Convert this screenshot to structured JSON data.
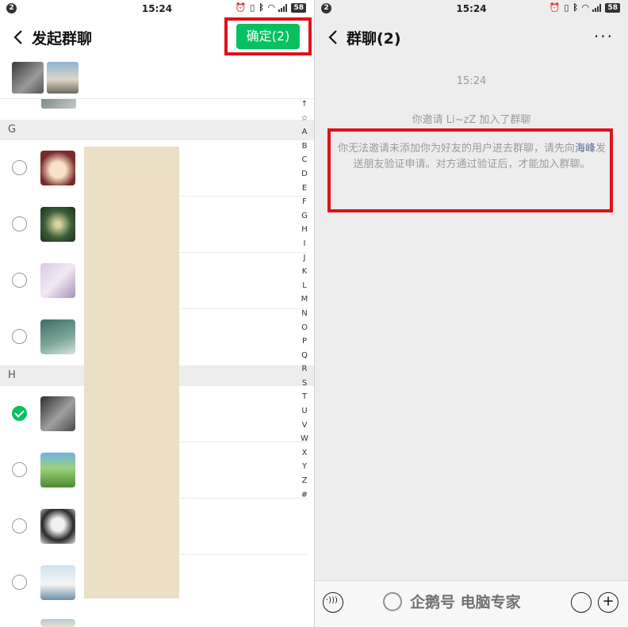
{
  "left": {
    "status": {
      "notif": "2",
      "time": "15:24",
      "battery": "58"
    },
    "nav": {
      "title": "发起群聊",
      "confirm_label": "确定(2)"
    },
    "sections": [
      {
        "letter": "G"
      },
      {
        "letter": "H"
      }
    ],
    "index_letters": [
      "↑",
      "☆",
      "A",
      "B",
      "C",
      "D",
      "E",
      "F",
      "G",
      "H",
      "I",
      "J",
      "K",
      "L",
      "M",
      "N",
      "O",
      "P",
      "Q",
      "R",
      "S",
      "T",
      "U",
      "V",
      "W",
      "X",
      "Y",
      "Z",
      "#"
    ],
    "contacts": [
      {
        "section": "G",
        "checked": false
      },
      {
        "section": "G",
        "checked": false
      },
      {
        "section": "G",
        "checked": false
      },
      {
        "section": "G",
        "checked": false
      },
      {
        "section": "H",
        "checked": true
      },
      {
        "section": "H",
        "checked": false
      },
      {
        "section": "H",
        "checked": false
      },
      {
        "section": "H",
        "checked": false
      }
    ]
  },
  "right": {
    "status": {
      "notif": "2",
      "time": "15:24",
      "battery": "58"
    },
    "nav": {
      "title": "群聊(2)",
      "more": "···"
    },
    "chat": {
      "time": "15:24",
      "sys1": "你邀请 Li~zZ 加入了群聊",
      "sys2_prefix": "你无法邀请未添加你为好友的用户进去群聊，请先向",
      "sys2_name": "海峰",
      "sys2_suffix": "发送朋友验证申请。对方通过验证后，才能加入群聊。"
    },
    "bottom": {
      "watermark": "企鹅号 电脑专家"
    }
  }
}
